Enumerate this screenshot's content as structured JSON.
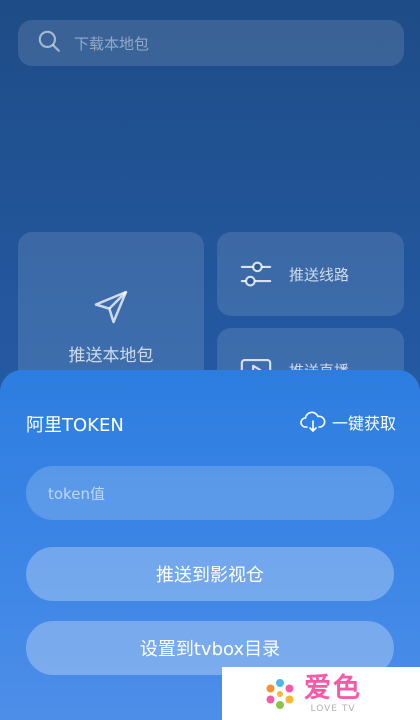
{
  "search": {
    "placeholder": "下载本地包"
  },
  "cards": {
    "push_local": "推送本地包",
    "push_routes": "推送线路",
    "push_live": "推送直播"
  },
  "sheet": {
    "title": "阿里TOKEN",
    "fetch_label": "一键获取",
    "token_placeholder": "token值",
    "btn_push_repo": "推送到影视仓",
    "btn_set_tvbox": "设置到tvbox目录"
  },
  "watermark": {
    "brand": "爱色",
    "sub": "LOVE TV"
  },
  "colors": {
    "background": "#2358a0",
    "sheet": "#3d86e6",
    "watermark_pink": "#f45aa8"
  }
}
